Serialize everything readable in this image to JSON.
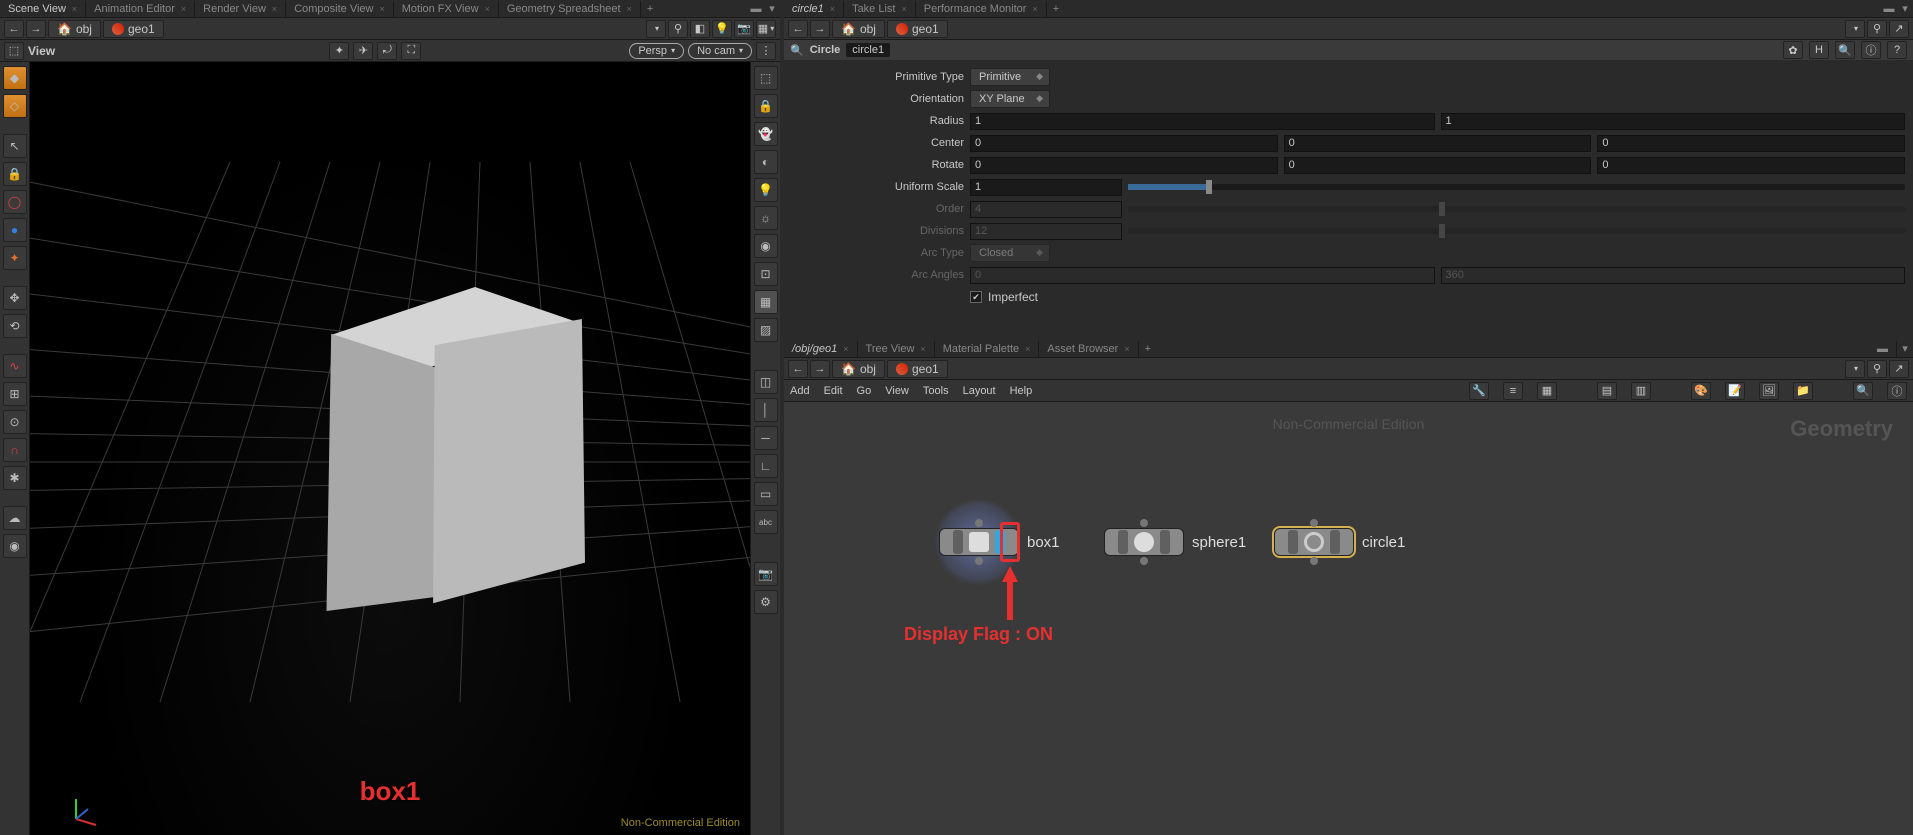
{
  "left": {
    "tabs": [
      "Scene View",
      "Animation Editor",
      "Render View",
      "Composite View",
      "Motion FX View",
      "Geometry Spreadsheet"
    ],
    "path": {
      "level1": "obj",
      "level2": "geo1"
    },
    "view_label": "View",
    "persp": "Persp",
    "nocam": "No cam",
    "viewport_label": "box1",
    "status": "Non-Commercial Edition"
  },
  "params": {
    "tabs": [
      "circle1",
      "Take List",
      "Performance Monitor"
    ],
    "path": {
      "level1": "obj",
      "level2": "geo1"
    },
    "type": "Circle",
    "name": "circle1",
    "rows": {
      "prim_type": {
        "label": "Primitive Type",
        "value": "Primitive"
      },
      "orient": {
        "label": "Orientation",
        "value": "XY Plane"
      },
      "radius": {
        "label": "Radius",
        "x": "1",
        "y": "1"
      },
      "center": {
        "label": "Center",
        "x": "0",
        "y": "0",
        "z": "0"
      },
      "rotate": {
        "label": "Rotate",
        "x": "0",
        "y": "0",
        "z": "0"
      },
      "uscale": {
        "label": "Uniform Scale",
        "v": "1"
      },
      "order": {
        "label": "Order",
        "v": "4"
      },
      "div": {
        "label": "Divisions",
        "v": "12"
      },
      "arc": {
        "label": "Arc Type",
        "value": "Closed"
      },
      "arcang": {
        "label": "Arc Angles",
        "a": "0",
        "b": "360"
      },
      "imperf": {
        "label": "Imperfect"
      }
    }
  },
  "network": {
    "tabs": [
      "/obj/geo1",
      "Tree View",
      "Material Palette",
      "Asset Browser"
    ],
    "path": {
      "level1": "obj",
      "level2": "geo1"
    },
    "menu": [
      "Add",
      "Edit",
      "Go",
      "View",
      "Tools",
      "Layout",
      "Help"
    ],
    "watermark_left": "Non-Commercial Edition",
    "watermark_right": "Geometry",
    "nodes": {
      "box": {
        "label": "box1"
      },
      "sphere": {
        "label": "sphere1"
      },
      "circle": {
        "label": "circle1"
      }
    },
    "annotation": "Display Flag : ON"
  }
}
